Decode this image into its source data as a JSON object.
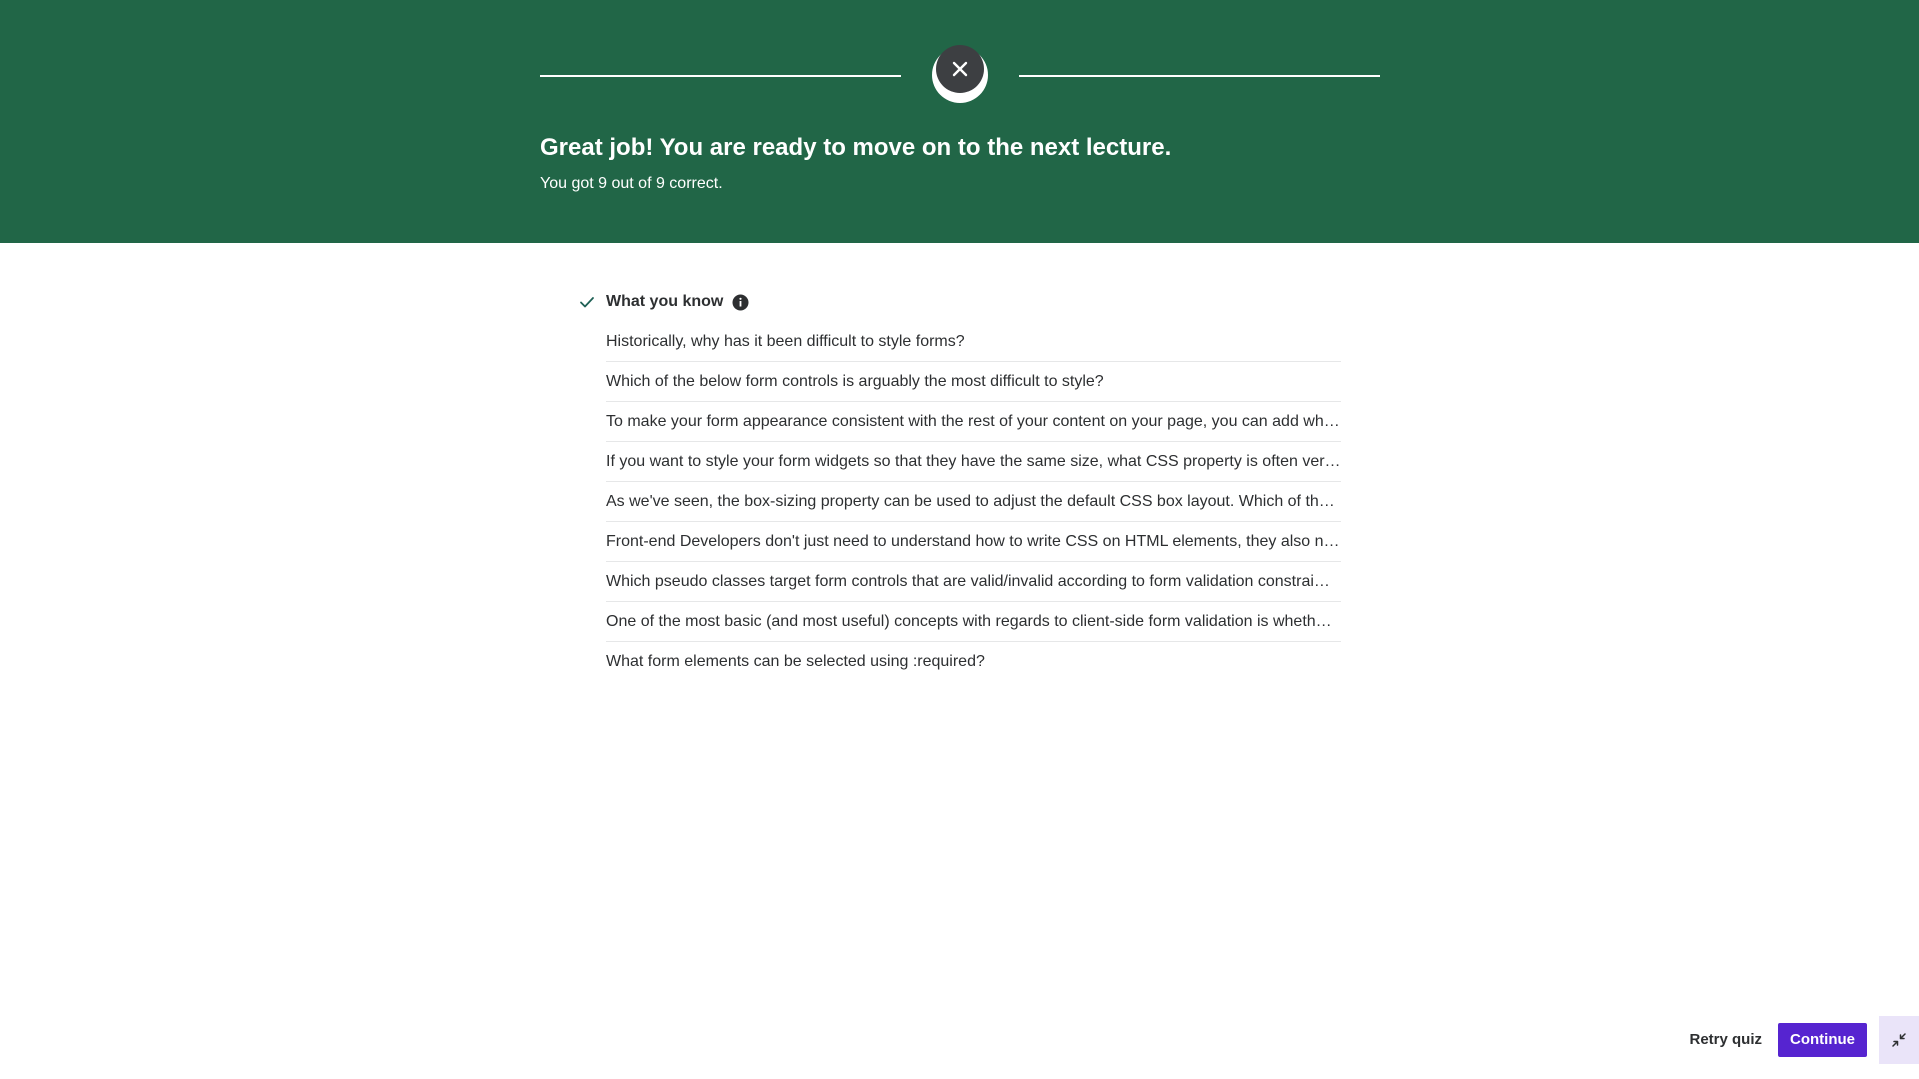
{
  "banner": {
    "title": "Great job! You are ready to move on to the next lecture.",
    "subtitle": "You got 9 out of 9 correct.",
    "color": "#216647"
  },
  "section": {
    "title": "What you know",
    "check_icon": "check-icon",
    "info_icon": "info-icon"
  },
  "questions": [
    "Historically, why has it been difficult to style forms?",
    "Which of the below form controls is arguably the most difficult to style?",
    "To make your form appearance consistent with the rest of your content on your page, you can add wh…",
    "If you want to style your form widgets so that they have the same size, what CSS property is often ver…",
    "As we've seen, the box-sizing property can be used to adjust the default CSS box layout. Which of the…",
    "Front-end Developers don't just need to understand how to write CSS on HTML elements, they also n…",
    "Which pseudo classes target form controls that are valid/invalid according to form validation constrai…",
    "One of the most basic (and most useful) concepts with regards to client-side form validation is wheth…",
    "What form elements can be selected using :required?"
  ],
  "footer": {
    "retry_label": "Retry quiz",
    "continue_label": "Continue",
    "shrink_icon": "shrink-icon",
    "accent": "#5624d0"
  }
}
